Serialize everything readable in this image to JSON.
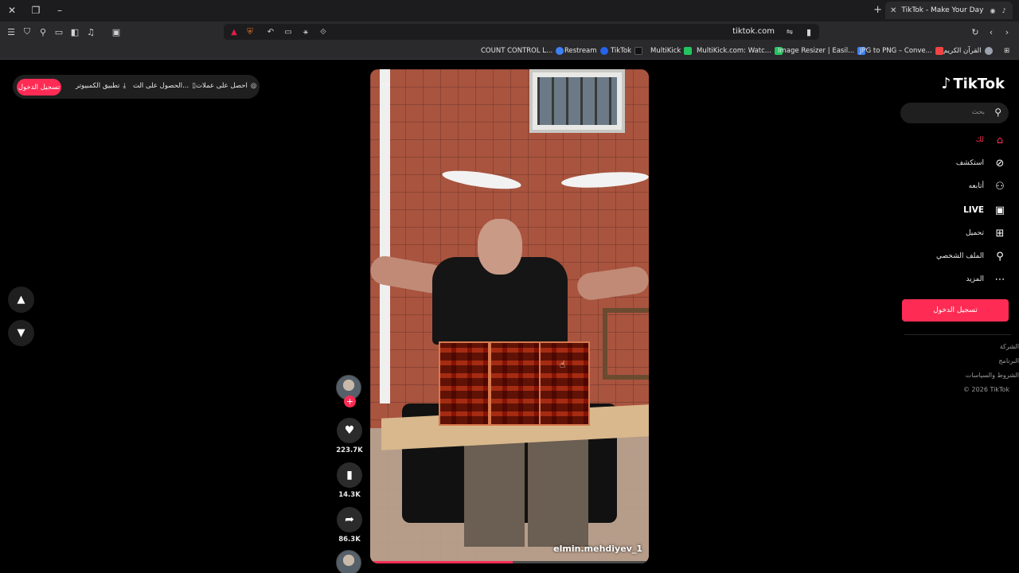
{
  "browser": {
    "tab_title": "TikTok - Make Your Day",
    "url": "tiktok.com",
    "bookmarks": [
      {
        "label": "COUNT CONTROL L...",
        "color": "#3b82f6"
      },
      {
        "label": "Restream",
        "color": "#2563eb"
      },
      {
        "label": "TikTok",
        "color": "#111111"
      },
      {
        "label": "MultiKick",
        "color": "#22c55e"
      },
      {
        "label": "MultiKick.com: Watc...",
        "color": "#22c55e"
      },
      {
        "label": "Image Resizer | Easil...",
        "color": "#3b82f6"
      },
      {
        "label": "JPG to PNG – Conve...",
        "color": "#ef4444"
      },
      {
        "label": "القرآن الكريم",
        "color": "#9ca3af"
      }
    ]
  },
  "top_bar": {
    "login_label": "تسجيل الدخول",
    "desktop_app_label": "تطبيق الكمبيوتر",
    "get_app_label": "الحصول على الت...",
    "coins_label": "احصل على عملات"
  },
  "sidebar": {
    "logo_text": "TikTok",
    "search_placeholder": "بحث",
    "nav": [
      {
        "label": "لك",
        "icon": "home-icon"
      },
      {
        "label": "استكشف",
        "icon": "compass-icon"
      },
      {
        "label": "أتابعه",
        "icon": "following-icon"
      },
      {
        "label": "LIVE",
        "icon": "live-icon"
      },
      {
        "label": "تحميل",
        "icon": "upload-icon"
      },
      {
        "label": "الملف الشخصي",
        "icon": "profile-icon"
      },
      {
        "label": "المزيد",
        "icon": "more-icon"
      }
    ],
    "login_button": "تسجيل الدخول",
    "footer": {
      "company": "الشركة",
      "program": "البرنامج",
      "terms": "الشروط والسياسات",
      "copyright": "© 2026 TikTok"
    }
  },
  "video": {
    "watermark": "elmin.mehdiyev_1",
    "progress": 0.51,
    "likes": "223.7K",
    "saves": "14.3K",
    "shares": "86.3K"
  },
  "colors": {
    "accent": "#fe2c55",
    "background": "#000000"
  }
}
